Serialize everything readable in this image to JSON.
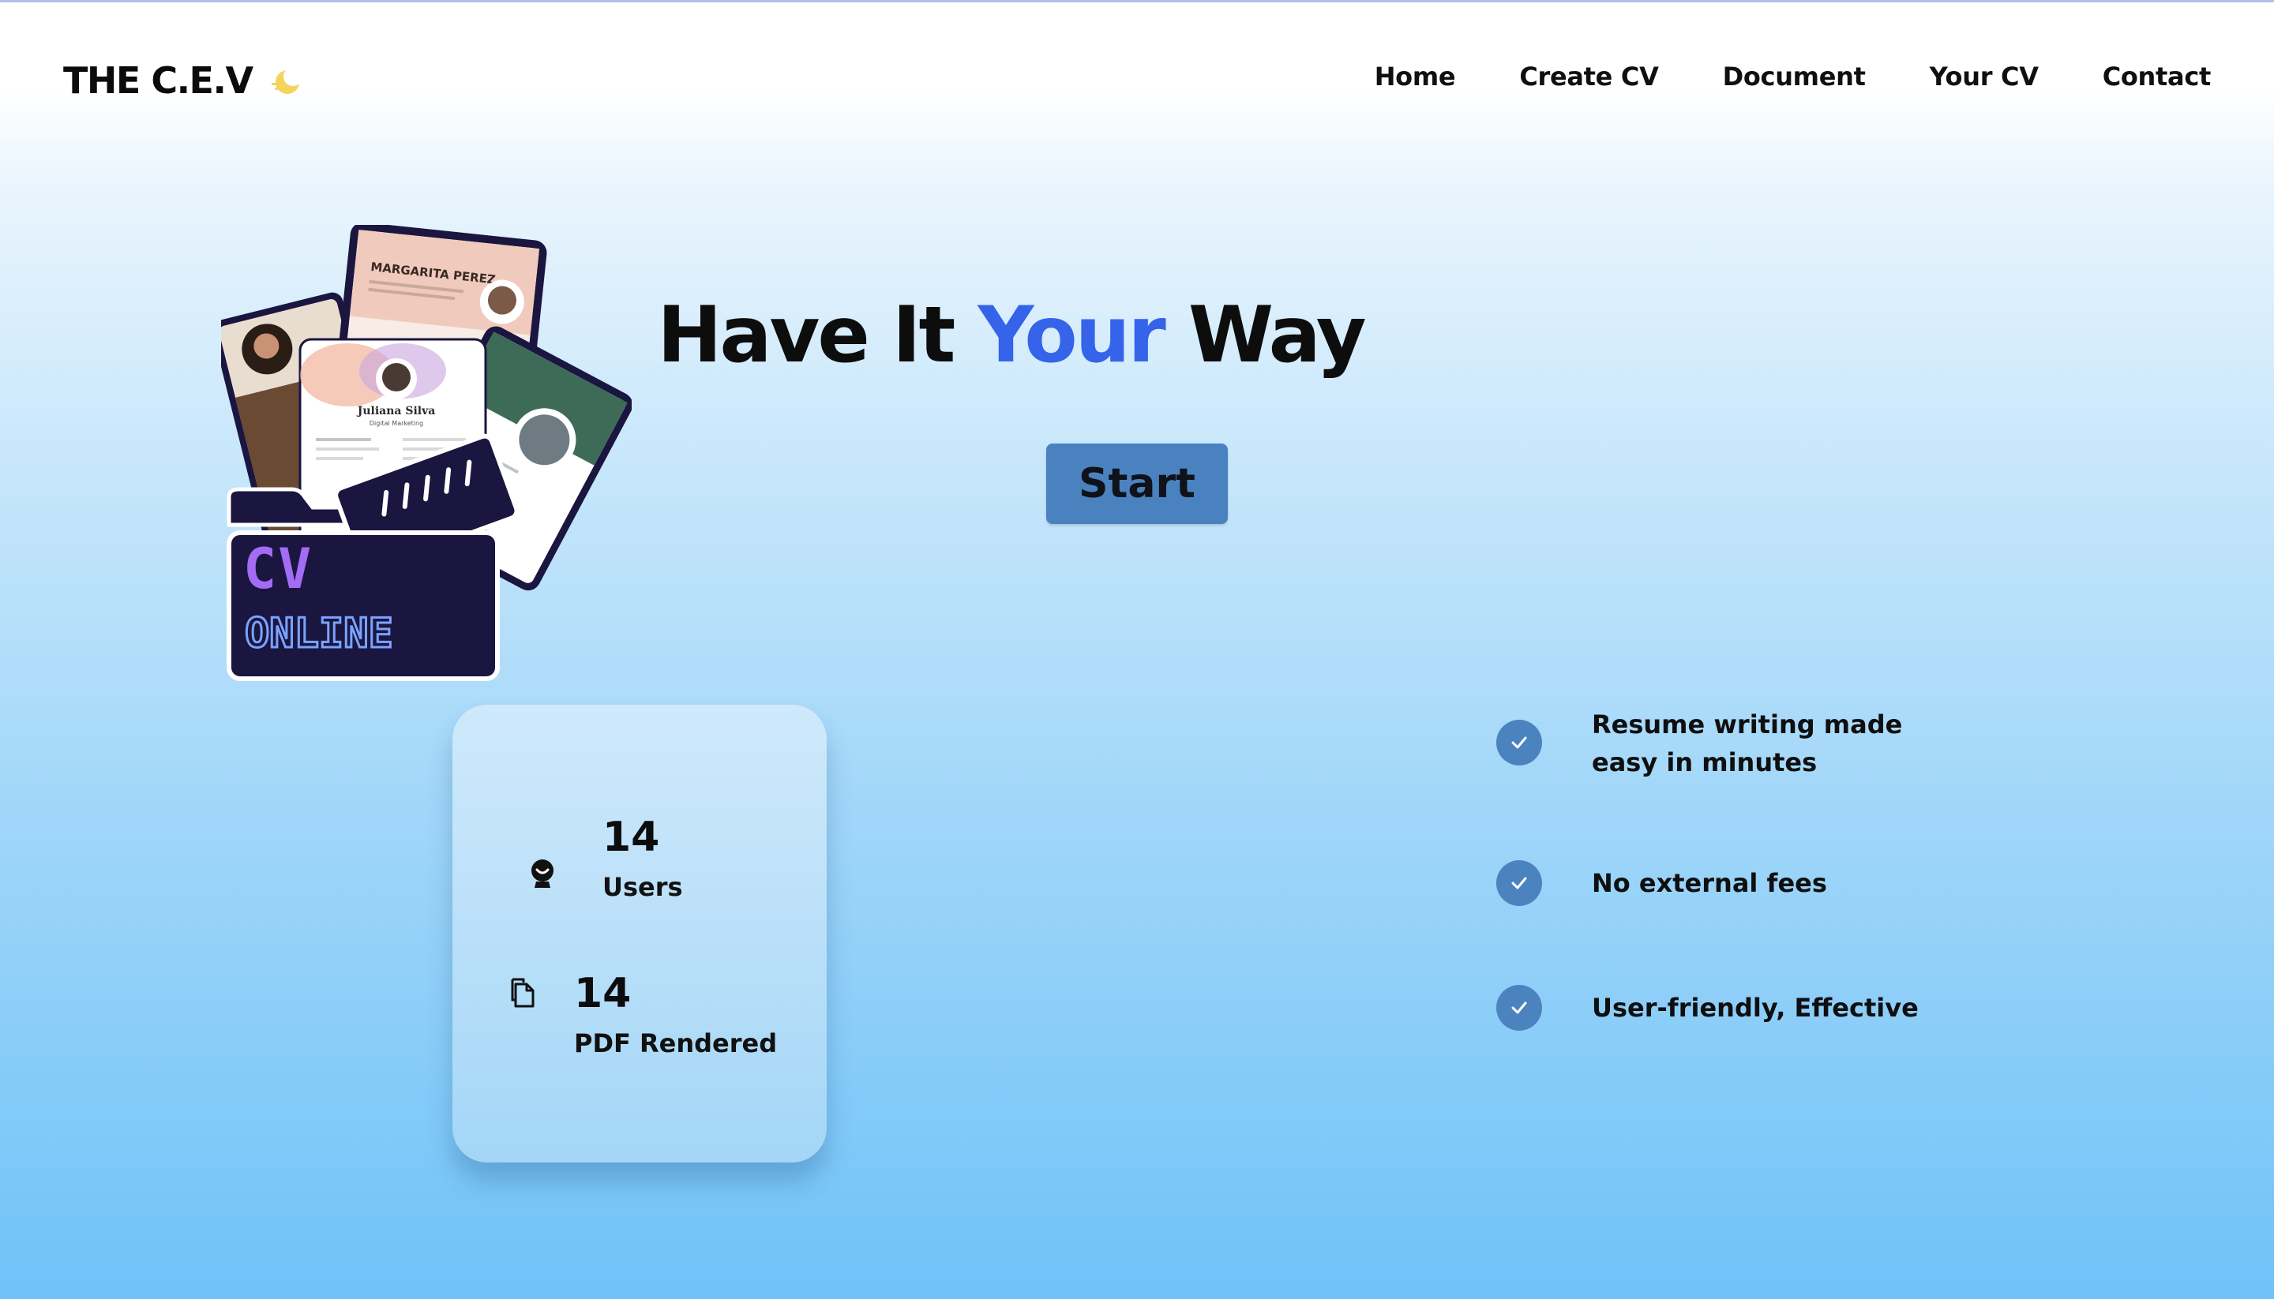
{
  "brand": {
    "name": "THE C.E.V",
    "icon": "moon-sun-icon"
  },
  "nav": {
    "items": [
      "Home",
      "Create CV",
      "Document",
      "Your CV",
      "Contact"
    ]
  },
  "hero": {
    "title_part1": "Have It",
    "title_accent": "Your",
    "title_part2": "Way",
    "start_label": "Start",
    "illustration": {
      "folder_line1": "CV",
      "folder_line2": "ONLINE",
      "card_name_1": "MARGARITA PEREZ",
      "card_name_2": "Juliana Silva",
      "card_subtitle_2": "Digital Marketing"
    }
  },
  "stats": [
    {
      "icon": "user-icon",
      "value": "14",
      "label": "Users"
    },
    {
      "icon": "document-icon",
      "value": "14",
      "label": "PDF Rendered"
    }
  ],
  "features": [
    {
      "icon": "check-icon",
      "text": "Resume writing made easy in minutes"
    },
    {
      "icon": "check-icon",
      "text": "No external fees"
    },
    {
      "icon": "check-icon",
      "text": "User-friendly, Effective"
    }
  ],
  "colors": {
    "accent": "#3563e9",
    "button": "#4a82c0",
    "check": "#4b83bf",
    "folder": "#1a1640",
    "cv_purple": "#a26cf5",
    "online_blue": "#7aa3ff"
  }
}
